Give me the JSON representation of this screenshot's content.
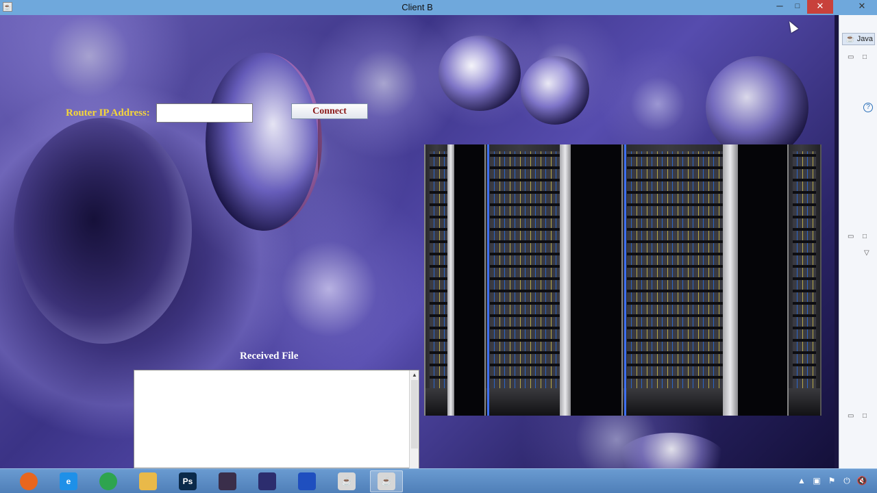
{
  "window": {
    "title": "Client B",
    "minimize_symbol": "─",
    "maximize_symbol": "□",
    "close_symbol": "✕"
  },
  "form": {
    "router_label": "Router IP Address:",
    "router_ip_value": "",
    "connect_label": "Connect"
  },
  "received": {
    "label": "Received File",
    "content": ""
  },
  "side_panel": {
    "perspective_label": "Java",
    "help_symbol": "?"
  },
  "taskbar": {
    "items": [
      {
        "name": "firefox",
        "icon": "firefox-icon",
        "glyph": "",
        "color": "#e8661e",
        "active": false
      },
      {
        "name": "internet-explorer",
        "icon": "internet-explorer-icon",
        "glyph": "e",
        "color": "#1e90e8",
        "active": false
      },
      {
        "name": "chrome",
        "icon": "chrome-icon",
        "glyph": "",
        "color": "#2ea44f",
        "active": false
      },
      {
        "name": "file-explorer",
        "icon": "folder-icon",
        "glyph": "",
        "color": "#e9b949",
        "active": false
      },
      {
        "name": "photoshop",
        "icon": "photoshop-icon",
        "glyph": "Ps",
        "color": "#0b2a4a",
        "active": false
      },
      {
        "name": "java-ee-ide",
        "icon": "java-ee-ide-icon",
        "glyph": "",
        "color": "#3a2e4a",
        "active": false
      },
      {
        "name": "eclipse",
        "icon": "eclipse-icon",
        "glyph": "",
        "color": "#2c2d6e",
        "active": false
      },
      {
        "name": "remote-app",
        "icon": "remote-app-icon",
        "glyph": "",
        "color": "#1f4fbf",
        "active": false
      },
      {
        "name": "java-app-1",
        "icon": "java-cup-icon",
        "glyph": "",
        "color": "#d7d7d7",
        "active": false
      },
      {
        "name": "java-app-2",
        "icon": "java-cup-icon",
        "glyph": "",
        "color": "#d7d7d7",
        "active": true
      }
    ]
  },
  "colors": {
    "label_yellow": "#f5d63a",
    "connect_text": "#8b1a1a",
    "titlebar": "#6fa8dc",
    "close_red": "#c8413b",
    "taskbar": "#5b8cc6"
  }
}
